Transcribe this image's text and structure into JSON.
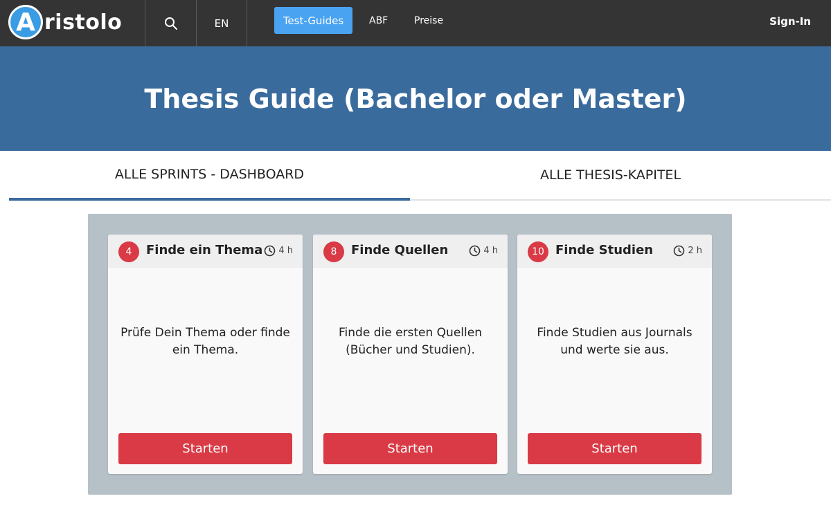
{
  "navbar": {
    "logo_letter": "A",
    "logo_text": "ristolo",
    "search_icon": "search-icon",
    "language": "EN",
    "links": [
      "Test-Guides",
      "ABF",
      "Preise"
    ],
    "active_link": "Test-Guides",
    "signin": "Sign-In"
  },
  "hero": {
    "title": "Thesis Guide (Bachelor oder Master)"
  },
  "tabs": [
    {
      "label": "ALLE SPRINTS - DASHBOARD",
      "active": true
    },
    {
      "label": "ALLE THESIS-KAPITEL",
      "active": false
    }
  ],
  "cards": [
    {
      "number": "4",
      "title": "Finde ein Thema",
      "duration": "4 h",
      "description": "Prüfe Dein Thema oder finde ein Thema.",
      "button": "Starten"
    },
    {
      "number": "8",
      "title": "Finde Quellen",
      "duration": "4 h",
      "description": "Finde die ersten Quellen (Bücher und Studien).",
      "button": "Starten"
    },
    {
      "number": "10",
      "title": "Finde Studien",
      "duration": "2 h",
      "description": "Finde Studien aus Journals und werte sie aus.",
      "button": "Starten"
    }
  ],
  "colors": {
    "navbar": "#343434",
    "accent_blue": "#4aa3f0",
    "hero": "#3a6b9d",
    "panel": "#b6c0c7",
    "primary_red": "#d93a45"
  }
}
